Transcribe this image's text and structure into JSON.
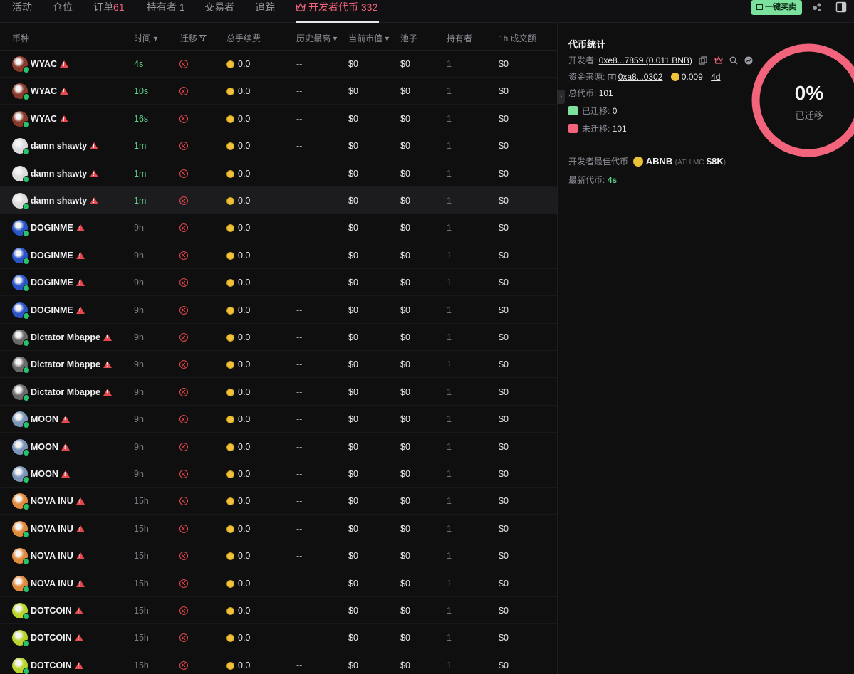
{
  "tabs": [
    {
      "label": "活动",
      "count": ""
    },
    {
      "label": "仓位",
      "count": ""
    },
    {
      "label": "订单",
      "count": "61"
    },
    {
      "label": "持有者",
      "count": "1"
    },
    {
      "label": "交易者",
      "count": ""
    },
    {
      "label": "追踪",
      "count": ""
    },
    {
      "label": "开发者代币",
      "count": "332"
    }
  ],
  "active_tab": "开发者代币",
  "toolbar": {
    "quick_trade_label": "一键买卖"
  },
  "columns": [
    "币种",
    "时间",
    "迁移",
    "总手续费",
    "历史最高",
    "当前市值",
    "池子",
    "持有者",
    "1h 成交额"
  ],
  "sort_arrow": "▾",
  "rows": [
    {
      "name": "WYAC",
      "age": "4s",
      "fee": "0.0",
      "ath": "--",
      "mc": "$0",
      "pool": "$0",
      "holders": "1",
      "vol": "$0",
      "fresh": true,
      "avatar_color": "#8a3a2a"
    },
    {
      "name": "WYAC",
      "age": "10s",
      "fee": "0.0",
      "ath": "--",
      "mc": "$0",
      "pool": "$0",
      "holders": "1",
      "vol": "$0",
      "fresh": true,
      "avatar_color": "#8a3a2a"
    },
    {
      "name": "WYAC",
      "age": "16s",
      "fee": "0.0",
      "ath": "--",
      "mc": "$0",
      "pool": "$0",
      "holders": "1",
      "vol": "$0",
      "fresh": true,
      "avatar_color": "#8a3a2a"
    },
    {
      "name": "damn shawty",
      "age": "1m",
      "fee": "0.0",
      "ath": "--",
      "mc": "$0",
      "pool": "$0",
      "holders": "1",
      "vol": "$0",
      "fresh": true,
      "avatar_color": "#dcdcdc"
    },
    {
      "name": "damn shawty",
      "age": "1m",
      "fee": "0.0",
      "ath": "--",
      "mc": "$0",
      "pool": "$0",
      "holders": "1",
      "vol": "$0",
      "fresh": true,
      "avatar_color": "#dcdcdc"
    },
    {
      "name": "damn shawty",
      "age": "1m",
      "fee": "0.0",
      "ath": "--",
      "mc": "$0",
      "pool": "$0",
      "holders": "1",
      "vol": "$0",
      "fresh": true,
      "avatar_color": "#dcdcdc",
      "highlight": true
    },
    {
      "name": "DOGINME",
      "age": "9h",
      "fee": "0.0",
      "ath": "--",
      "mc": "$0",
      "pool": "$0",
      "holders": "1",
      "vol": "$0",
      "fresh": false,
      "avatar_color": "#2b56c9"
    },
    {
      "name": "DOGINME",
      "age": "9h",
      "fee": "0.0",
      "ath": "--",
      "mc": "$0",
      "pool": "$0",
      "holders": "1",
      "vol": "$0",
      "fresh": false,
      "avatar_color": "#2b56c9"
    },
    {
      "name": "DOGINME",
      "age": "9h",
      "fee": "0.0",
      "ath": "--",
      "mc": "$0",
      "pool": "$0",
      "holders": "1",
      "vol": "$0",
      "fresh": false,
      "avatar_color": "#2b56c9"
    },
    {
      "name": "DOGINME",
      "age": "9h",
      "fee": "0.0",
      "ath": "--",
      "mc": "$0",
      "pool": "$0",
      "holders": "1",
      "vol": "$0",
      "fresh": false,
      "avatar_color": "#2b56c9"
    },
    {
      "name": "Dictator Mbappe",
      "age": "9h",
      "fee": "0.0",
      "ath": "--",
      "mc": "$0",
      "pool": "$0",
      "holders": "1",
      "vol": "$0",
      "fresh": false,
      "avatar_color": "#6a6a6a"
    },
    {
      "name": "Dictator Mbappe",
      "age": "9h",
      "fee": "0.0",
      "ath": "--",
      "mc": "$0",
      "pool": "$0",
      "holders": "1",
      "vol": "$0",
      "fresh": false,
      "avatar_color": "#6a6a6a"
    },
    {
      "name": "Dictator Mbappe",
      "age": "9h",
      "fee": "0.0",
      "ath": "--",
      "mc": "$0",
      "pool": "$0",
      "holders": "1",
      "vol": "$0",
      "fresh": false,
      "avatar_color": "#6a6a6a"
    },
    {
      "name": "MOON",
      "age": "9h",
      "fee": "0.0",
      "ath": "--",
      "mc": "$0",
      "pool": "$0",
      "holders": "1",
      "vol": "$0",
      "fresh": false,
      "avatar_color": "#7a95b8"
    },
    {
      "name": "MOON",
      "age": "9h",
      "fee": "0.0",
      "ath": "--",
      "mc": "$0",
      "pool": "$0",
      "holders": "1",
      "vol": "$0",
      "fresh": false,
      "avatar_color": "#7a95b8"
    },
    {
      "name": "MOON",
      "age": "9h",
      "fee": "0.0",
      "ath": "--",
      "mc": "$0",
      "pool": "$0",
      "holders": "1",
      "vol": "$0",
      "fresh": false,
      "avatar_color": "#7a95b8"
    },
    {
      "name": "NOVA INU",
      "age": "15h",
      "fee": "0.0",
      "ath": "--",
      "mc": "$0",
      "pool": "$0",
      "holders": "1",
      "vol": "$0",
      "fresh": false,
      "avatar_color": "#e08a3c"
    },
    {
      "name": "NOVA INU",
      "age": "15h",
      "fee": "0.0",
      "ath": "--",
      "mc": "$0",
      "pool": "$0",
      "holders": "1",
      "vol": "$0",
      "fresh": false,
      "avatar_color": "#e08a3c"
    },
    {
      "name": "NOVA INU",
      "age": "15h",
      "fee": "0.0",
      "ath": "--",
      "mc": "$0",
      "pool": "$0",
      "holders": "1",
      "vol": "$0",
      "fresh": false,
      "avatar_color": "#e08a3c"
    },
    {
      "name": "NOVA INU",
      "age": "15h",
      "fee": "0.0",
      "ath": "--",
      "mc": "$0",
      "pool": "$0",
      "holders": "1",
      "vol": "$0",
      "fresh": false,
      "avatar_color": "#e08a3c"
    },
    {
      "name": "DOTCOIN",
      "age": "15h",
      "fee": "0.0",
      "ath": "--",
      "mc": "$0",
      "pool": "$0",
      "holders": "1",
      "vol": "$0",
      "fresh": false,
      "avatar_color": "#b9d42a"
    },
    {
      "name": "DOTCOIN",
      "age": "15h",
      "fee": "0.0",
      "ath": "--",
      "mc": "$0",
      "pool": "$0",
      "holders": "1",
      "vol": "$0",
      "fresh": false,
      "avatar_color": "#b9d42a"
    },
    {
      "name": "DOTCOIN",
      "age": "15h",
      "fee": "0.0",
      "ath": "--",
      "mc": "$0",
      "pool": "$0",
      "holders": "1",
      "vol": "$0",
      "fresh": false,
      "avatar_color": "#b9d42a"
    }
  ],
  "side": {
    "title": "代币统计",
    "dev_label": "开发者:",
    "dev_address": "0xe8...7859 (0.011 BNB)",
    "funding_label": "资金来源:",
    "funding_address": "0xa8...0302",
    "funding_amount": "0.009",
    "funding_age": "4d",
    "total_label": "总代币:",
    "total_value": "101",
    "migrated_label": "已迁移:",
    "migrated_value": "0",
    "not_migrated_label": "未迁移:",
    "not_migrated_value": "101",
    "best_label": "开发者最佳代币",
    "best_token": "ABNB",
    "best_ath_label": "(ATH MC",
    "best_ath_value": "$8K",
    "best_ath_close": ")",
    "latest_label": "最新代币:",
    "latest_value": "4s",
    "donut_pct": "0%",
    "donut_label": "已迁移",
    "migrated_fraction": 0,
    "migrated_color": "#7be19c",
    "not_migrated_color": "#f2647c"
  }
}
